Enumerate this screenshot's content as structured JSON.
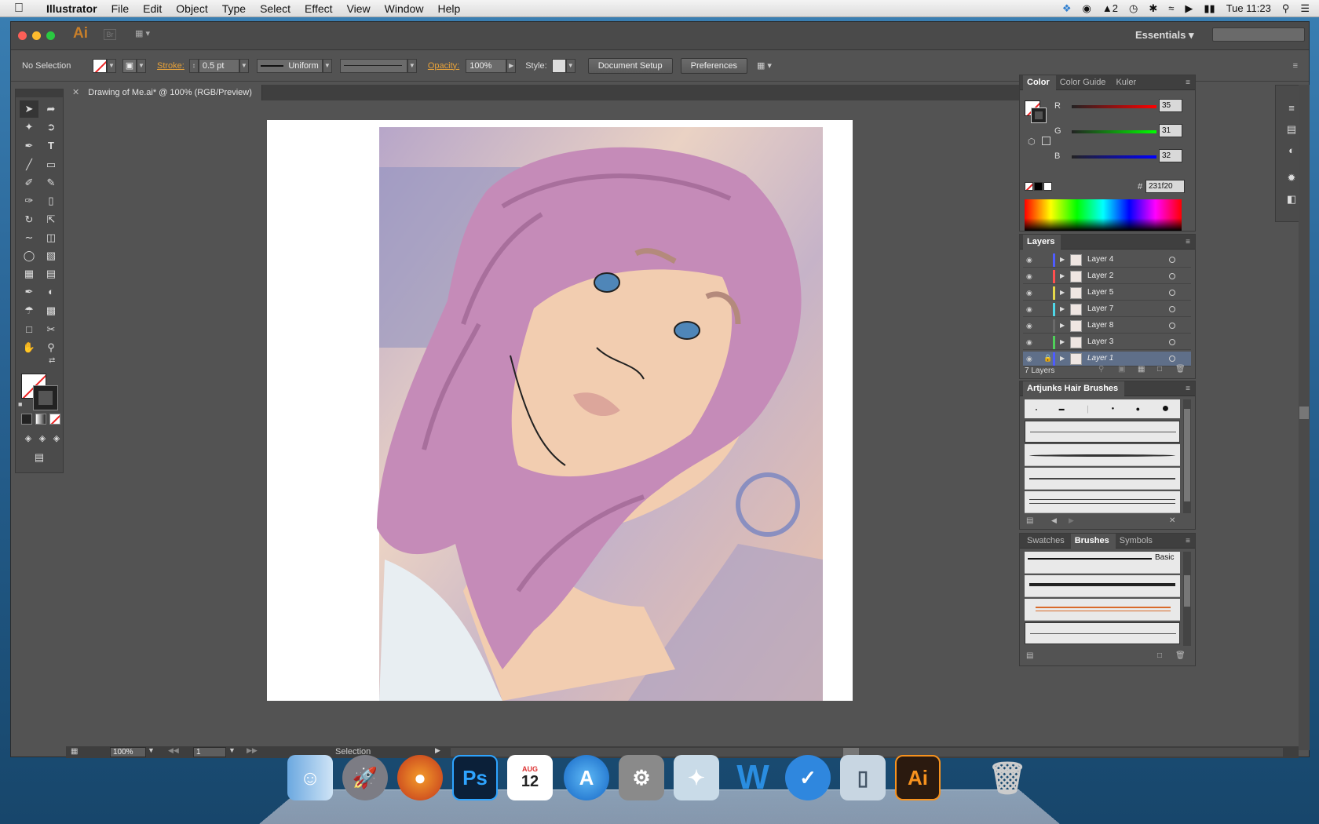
{
  "menubar": {
    "apple": "",
    "app": "Illustrator",
    "items": [
      "File",
      "Edit",
      "Object",
      "Type",
      "Select",
      "Effect",
      "View",
      "Window",
      "Help"
    ],
    "status": {
      "adobe_count": "2",
      "time": "Tue 11:23"
    }
  },
  "titlebar": {
    "ai_logo": "Ai",
    "br_logo": "Br",
    "workspace": "Essentials"
  },
  "control": {
    "selection": "No Selection",
    "stroke_label": "Stroke:",
    "stroke_value": "0.5 pt",
    "profile": "Uniform",
    "opacity_label": "Opacity:",
    "opacity_value": "100%",
    "style_label": "Style:",
    "document_setup": "Document Setup",
    "preferences": "Preferences"
  },
  "document": {
    "tab": "Drawing of Me.ai* @ 100% (RGB/Preview)"
  },
  "status": {
    "zoom": "100%",
    "page": "1",
    "tool": "Selection"
  },
  "color_panel": {
    "tabs": [
      "Color",
      "Color Guide",
      "Kuler"
    ],
    "r_label": "R",
    "g_label": "G",
    "b_label": "B",
    "r": "35",
    "g": "31",
    "b": "32",
    "hex_label": "#",
    "hex": "231f20"
  },
  "layers_panel": {
    "title": "Layers",
    "layers": [
      {
        "name": "Layer 4",
        "color": "#4f5cff"
      },
      {
        "name": "Layer 2",
        "color": "#ff4f4f"
      },
      {
        "name": "Layer 5",
        "color": "#e6d94a"
      },
      {
        "name": "Layer 7",
        "color": "#4fd7e8"
      },
      {
        "name": "Layer 8",
        "color": "#6a6a6a"
      },
      {
        "name": "Layer 3",
        "color": "#4fd05a"
      },
      {
        "name": "Layer 1",
        "color": "#4f5cff"
      }
    ],
    "count": "7 Layers"
  },
  "hair_brushes": {
    "title": "Artjunks Hair Brushes"
  },
  "brushes_panel": {
    "tabs": [
      "Swatches",
      "Brushes",
      "Symbols"
    ],
    "basic": "Basic"
  },
  "dock_apps": [
    "Finder",
    "Launchpad",
    "Firefox",
    "Photoshop",
    "Calendar",
    "App Store",
    "System Preferences",
    "Preview",
    "Word",
    "Wunderlist",
    "Archive",
    "Illustrator",
    "Trash"
  ],
  "dock_labels": {
    "photoshop": "Ps",
    "calendar_month": "AUG",
    "calendar_day": "12",
    "illustrator": "Ai"
  },
  "colors": {
    "hair": "#c58bb8",
    "skin": "#f2cdb0",
    "accent": "#e7a23a"
  }
}
